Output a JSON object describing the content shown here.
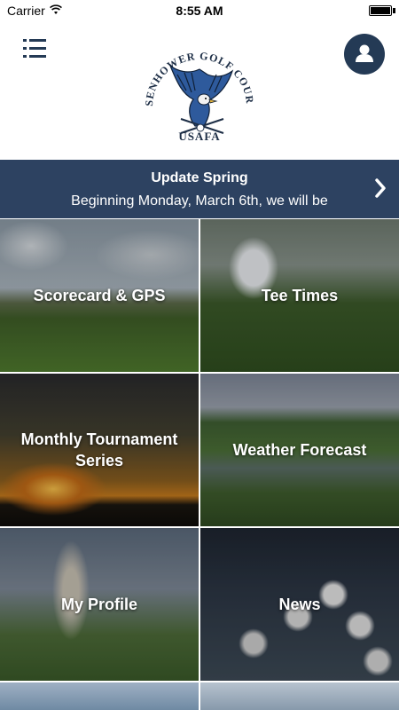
{
  "status_bar": {
    "carrier": "Carrier",
    "time": "8:55 AM",
    "battery_level": 1.0
  },
  "header": {
    "menu_icon": "list-menu-icon",
    "logo": {
      "arc_text": "EISENHOWER GOLF COURSE",
      "bottom_text": "USAFA"
    },
    "profile_icon": "user-icon"
  },
  "announcement": {
    "title": "Update Spring",
    "body": "Beginning Monday, March 6th, we will be",
    "chevron_icon": "chevron-right-icon"
  },
  "tiles": [
    {
      "label": "Scorecard & GPS"
    },
    {
      "label": "Tee Times"
    },
    {
      "label": "Monthly Tournament\nSeries"
    },
    {
      "label": "Weather Forecast"
    },
    {
      "label": "My Profile"
    },
    {
      "label": "News"
    },
    {
      "label": ""
    },
    {
      "label": ""
    }
  ],
  "colors": {
    "brand_navy": "#243a55",
    "banner_bg": "#2d4261",
    "text_on_dark": "#ffffff"
  }
}
